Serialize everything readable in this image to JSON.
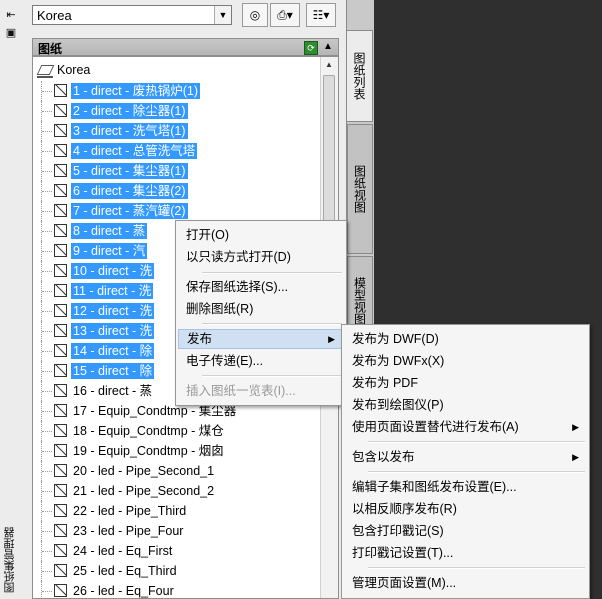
{
  "toolbar": {
    "sheetset_value": "Korea"
  },
  "left_strip": {
    "vertical_title": "图纸集管理器"
  },
  "panel": {
    "header_title": "图纸",
    "root_label": "Korea",
    "sheets": [
      {
        "label": "1 - direct - 废热锅炉(1)",
        "selected": true
      },
      {
        "label": "2 - direct - 除尘器(1)",
        "selected": true
      },
      {
        "label": "3 - direct - 洗气塔(1)",
        "selected": true
      },
      {
        "label": "4 - direct - 总管洗气塔",
        "selected": true
      },
      {
        "label": "5 - direct - 集尘器(1)",
        "selected": true
      },
      {
        "label": "6 - direct - 集尘器(2)",
        "selected": true
      },
      {
        "label": "7 - direct - 蒸汽罐(2)",
        "selected": true
      },
      {
        "label": "8 - direct - 蒸",
        "selected": true
      },
      {
        "label": "9 - direct - 汽",
        "selected": true
      },
      {
        "label": "10 - direct - 洗",
        "selected": true
      },
      {
        "label": "11 - direct - 洗",
        "selected": true
      },
      {
        "label": "12 - direct - 洗",
        "selected": true
      },
      {
        "label": "13 - direct - 洗",
        "selected": true
      },
      {
        "label": "14 - direct - 除",
        "selected": true
      },
      {
        "label": "15 - direct - 除",
        "selected": true
      },
      {
        "label": "16 - direct - 蒸",
        "selected": false
      },
      {
        "label": "17 - Equip_Condtmp - 集尘器",
        "selected": false
      },
      {
        "label": "18 - Equip_Condtmp - 煤仓",
        "selected": false
      },
      {
        "label": "19 - Equip_Condtmp - 烟囱",
        "selected": false
      },
      {
        "label": "20 - led - Pipe_Second_1",
        "selected": false
      },
      {
        "label": "21 - led - Pipe_Second_2",
        "selected": false
      },
      {
        "label": "22 - led - Pipe_Third",
        "selected": false
      },
      {
        "label": "23 - led - Pipe_Four",
        "selected": false
      },
      {
        "label": "24 - led - Eq_First",
        "selected": false
      },
      {
        "label": "25 - led - Eq_Third",
        "selected": false
      },
      {
        "label": "26 - led - Eq_Four",
        "selected": false
      }
    ]
  },
  "tabs": {
    "sheet_list": "图纸列表",
    "sheet_views": "图纸视图",
    "model_views": "模型视图"
  },
  "context_menu": {
    "open": "打开(O)",
    "open_readonly": "以只读方式打开(D)",
    "save_selection": "保存图纸选择(S)...",
    "delete_sheet": "删除图纸(R)",
    "publish": "发布",
    "etransmit": "电子传递(E)...",
    "insert_table": "插入图纸一览表(I)..."
  },
  "publish_submenu": {
    "dwf": "发布为 DWF(D)",
    "dwfx": "发布为 DWFx(X)",
    "pdf": "发布为 PDF",
    "plotter": "发布到绘图仪(P)",
    "page_setup_override": "使用页面设置替代进行发布(A)",
    "include_when_publishing": "包含以发布",
    "edit_settings": "编辑子集和图纸发布设置(E)...",
    "reverse_order": "以相反顺序发布(R)",
    "include_plot_stamp": "包含打印戳记(S)",
    "plot_stamp_settings": "打印戳记设置(T)...",
    "manage_page_setups": "管理页面设置(M)..."
  }
}
